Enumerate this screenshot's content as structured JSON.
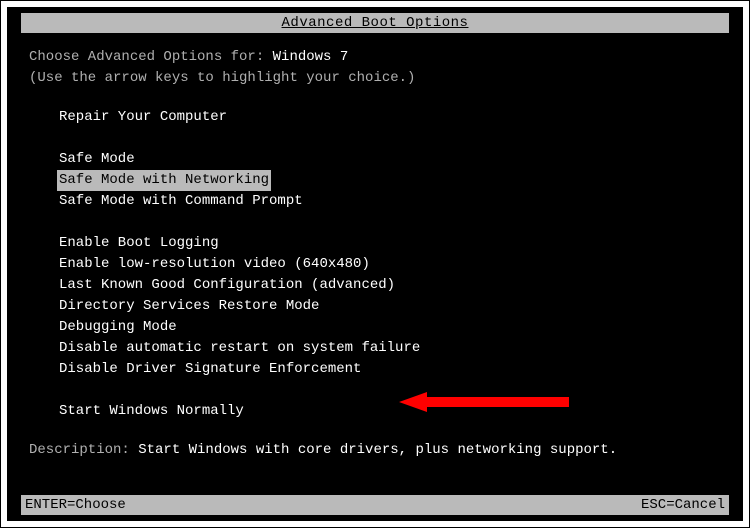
{
  "title": "Advanced Boot Options",
  "prompt_prefix": "Choose Advanced Options for: ",
  "os_name": "Windows 7",
  "hint": "(Use the arrow keys to highlight your choice.)",
  "menu": {
    "group1": [
      "Repair Your Computer"
    ],
    "group2": [
      "Safe Mode",
      "Safe Mode with Networking",
      "Safe Mode with Command Prompt"
    ],
    "group3": [
      "Enable Boot Logging",
      "Enable low-resolution video (640x480)",
      "Last Known Good Configuration (advanced)",
      "Directory Services Restore Mode",
      "Debugging Mode",
      "Disable automatic restart on system failure",
      "Disable Driver Signature Enforcement"
    ],
    "group4": [
      "Start Windows Normally"
    ],
    "selected": "Safe Mode with Networking"
  },
  "description_label": "Description: ",
  "description_text": "Start Windows with core drivers, plus networking support.",
  "footer": {
    "left": "ENTER=Choose",
    "right": "ESC=Cancel"
  }
}
